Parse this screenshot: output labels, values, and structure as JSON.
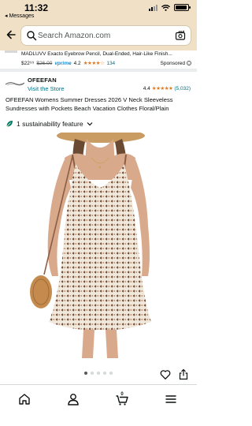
{
  "status_bar": {
    "time": "11:32",
    "back_app": "◂ Messages",
    "battery_level": 0.9
  },
  "search": {
    "placeholder": "Search Amazon.com"
  },
  "sponsored_item": {
    "title": "MADLUVV Exacto Eyebrow Pencil, Dual-Ended, Hair-Like Finish...",
    "price": "$22⁹⁹",
    "list_price": "$26.00",
    "prime": "vprime",
    "rating": "4.2",
    "stars": "★★★★☆",
    "review_count": "134",
    "label": "Sponsored",
    "info": "i"
  },
  "brand": {
    "name": "OFEEFAN",
    "visit_store": "Visit the Store",
    "rating": "4.4",
    "stars": "★★★★★",
    "review_count": "(5,032)"
  },
  "product": {
    "title": "OFEEFAN Womens Summer Dresses 2026 V Neck Sleeveless Sundresses with Pockets Beach Vacation Clothes Floral/Plain",
    "sustainability": "1 sustainability feature"
  },
  "gallery": {
    "image_count": 5,
    "active_index": 0
  },
  "bottom_nav": {
    "cart_count": "0",
    "items": [
      "home-icon",
      "account-icon",
      "cart-icon",
      "menu-icon"
    ]
  },
  "colors": {
    "header_bg": "#f0e0c6",
    "link": "#007185",
    "star": "#de7921",
    "prime": "#1a8ccd",
    "leaf": "#067d62"
  }
}
